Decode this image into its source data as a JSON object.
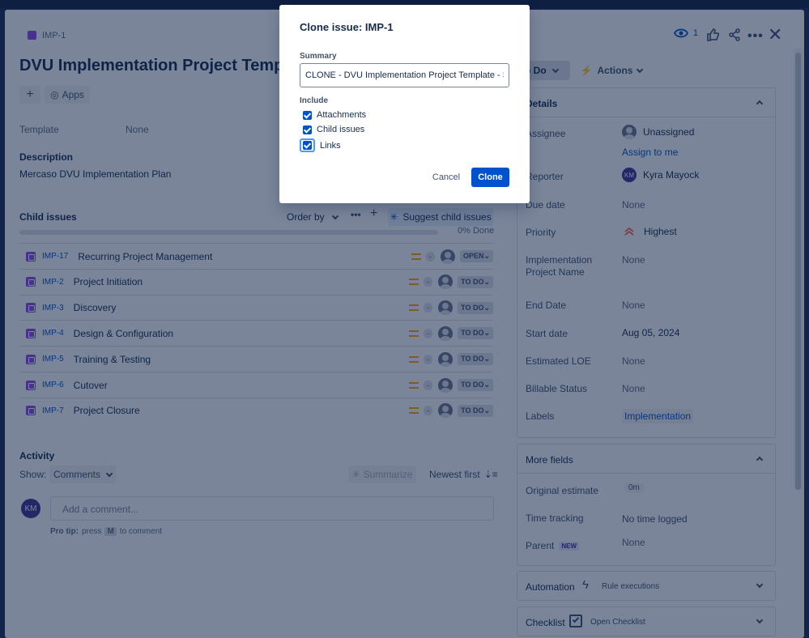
{
  "header": {
    "issue_key": "IMP-1",
    "title": "DVU Implementation Project Template",
    "apps_label": "Apps",
    "watch_count": "1"
  },
  "fields_left": {
    "template_label": "Template",
    "template_value": "None",
    "description_label": "Description",
    "description_value": "Mercaso DVU Implementation Plan"
  },
  "child_issues": {
    "label": "Child issues",
    "order_by": "Order by",
    "suggest": "Suggest child issues",
    "progress_text": "0% Done",
    "progress": 0,
    "rows": [
      {
        "key": "IMP-17",
        "summary": "Recurring Project Management",
        "estimate": "-",
        "status": "OPEN"
      },
      {
        "key": "IMP-2",
        "summary": "Project Initiation",
        "estimate": "-",
        "status": "TO DO"
      },
      {
        "key": "IMP-3",
        "summary": "Discovery",
        "estimate": "-",
        "status": "TO DO"
      },
      {
        "key": "IMP-4",
        "summary": "Design & Configuration",
        "estimate": "-",
        "status": "TO DO"
      },
      {
        "key": "IMP-5",
        "summary": "Training & Testing",
        "estimate": "-",
        "status": "TO DO"
      },
      {
        "key": "IMP-6",
        "summary": "Cutover",
        "estimate": "-",
        "status": "TO DO"
      },
      {
        "key": "IMP-7",
        "summary": "Project Closure",
        "estimate": "-",
        "status": "TO DO"
      }
    ]
  },
  "activity": {
    "label": "Activity",
    "show_label": "Show:",
    "show_value": "Comments",
    "summarize": "Summarize",
    "sort": "Newest first",
    "avatar_initials": "KM",
    "comment_placeholder": "Add a comment...",
    "pro_tip_bold": "Pro tip:",
    "pro_tip_press": "press",
    "pro_tip_key": "M",
    "pro_tip_rest": "to comment"
  },
  "right_panel": {
    "status_button": "o Do",
    "actions_button": "Actions",
    "details_title": "Details",
    "assignee_label": "Assignee",
    "assignee_value": "Unassigned",
    "assign_to_me": "Assign to me",
    "reporter_label": "Reporter",
    "reporter_initials": "KM",
    "reporter_value": "Kyra Mayock",
    "due_label": "Due date",
    "due_value": "None",
    "priority_label": "Priority",
    "priority_value": "Highest",
    "impl_name_label_1": "Implementation",
    "impl_name_label_2": "Project Name",
    "impl_name_value": "None",
    "end_label": "End Date",
    "end_value": "None",
    "start_label": "Start date",
    "start_value": "Aug 05, 2024",
    "loe_label": "Estimated LOE",
    "loe_value": "None",
    "billable_label": "Billable Status",
    "billable_value": "None",
    "labels_label": "Labels",
    "labels_value": "Implementation",
    "more_fields_title": "More fields",
    "orig_est_label": "Original estimate",
    "orig_est_value": "0m",
    "time_tracking_label": "Time tracking",
    "time_tracking_value": "No time logged",
    "parent_label": "Parent",
    "parent_badge": "NEW",
    "parent_value": "None",
    "automation_title": "Automation",
    "rule_exec": "Rule executions",
    "checklist_title": "Checklist",
    "open_checklist": "Open Checklist"
  },
  "modal": {
    "title": "Clone issue: IMP-1",
    "summary_label": "Summary",
    "summary_value": "CLONE - DVU Implementation Project Template - Sta",
    "include_label": "Include",
    "attachments": "Attachments",
    "child_issues": "Child issues",
    "links": "Links",
    "cancel": "Cancel",
    "clone": "Clone",
    "attachments_checked": true,
    "child_issues_checked": true,
    "links_checked": true
  },
  "colors": {
    "accent": "#0052cc",
    "overlay": "#1d2c53",
    "issue_purple": "#904ee2",
    "priority_medium": "#ffab00",
    "priority_highest": "#ff5630"
  }
}
